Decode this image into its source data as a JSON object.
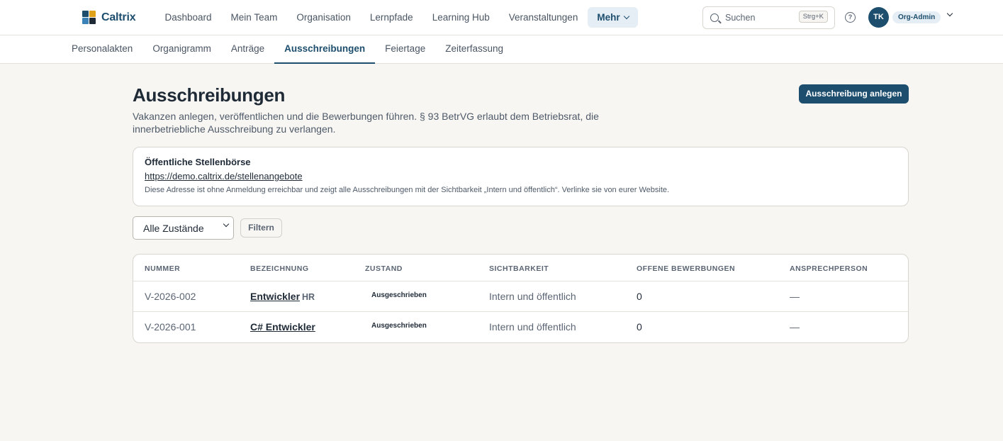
{
  "app": {
    "name": "Caltrix",
    "brand_colors": [
      "#1d4e6e",
      "#e0a21b",
      "#3b82b6",
      "#1f2a37"
    ]
  },
  "topnav": {
    "items": [
      "Dashboard",
      "Mein Team",
      "Organisation",
      "Lernpfade",
      "Learning Hub",
      "Veranstaltungen"
    ],
    "more_label": "Mehr"
  },
  "search": {
    "placeholder": "Suchen",
    "shortcut": "Strg+K"
  },
  "user": {
    "initials": "TK",
    "role": "Org-Admin"
  },
  "subnav": {
    "tabs": [
      "Personalakten",
      "Organigramm",
      "Anträge",
      "Ausschreibungen",
      "Feiertage",
      "Zeiterfassung"
    ],
    "active": "Ausschreibungen"
  },
  "page": {
    "title": "Ausschreibungen",
    "description": "Vakanzen anlegen, veröffentlichen und die Bewerbungen führen. § 93 BetrVG erlaubt dem Betriebsrat, die innerbetriebliche Ausschreibung zu verlangen.",
    "create_label": "Ausschreibung anlegen"
  },
  "jobboard": {
    "title": "Öffentliche Stellenbörse",
    "url": "https://demo.caltrix.de/stellenangebote",
    "note": "Diese Adresse ist ohne Anmeldung erreichbar und zeigt alle Ausschreibungen mit der Sichtbarkeit „Intern und öffentlich“. Verlinke sie von eurer Website."
  },
  "filter": {
    "selected": "Alle Zustände",
    "button_label": "Filtern"
  },
  "table": {
    "columns": [
      "NUMMER",
      "BEZEICHNUNG",
      "ZUSTAND",
      "SICHTBARKEIT",
      "OFFENE BEWERBUNGEN",
      "ANSPRECHPERSON"
    ],
    "rows": [
      {
        "number": "V-2026-002",
        "title": "Entwickler",
        "dept": "HR",
        "status": "Ausgeschrieben",
        "visibility": "Intern und öffentlich",
        "open": "0",
        "contact": "—"
      },
      {
        "number": "V-2026-001",
        "title": "C# Entwickler",
        "dept": "",
        "status": "Ausgeschrieben",
        "visibility": "Intern und öffentlich",
        "open": "0",
        "contact": "—"
      }
    ]
  }
}
